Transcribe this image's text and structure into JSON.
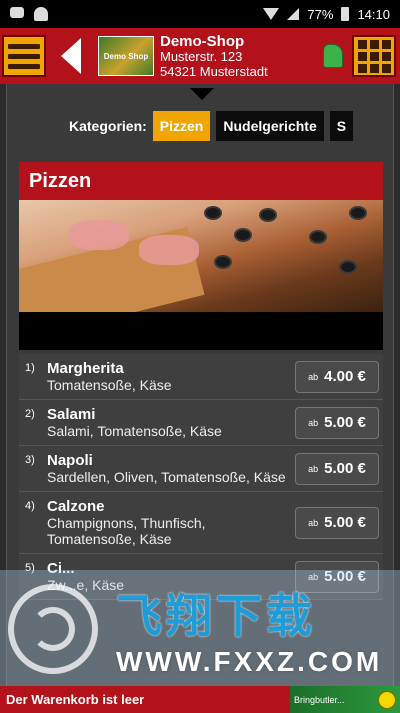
{
  "statusbar": {
    "battery": "77%",
    "time": "14:10"
  },
  "header": {
    "logo_text": "Demo Shop",
    "shop_name": "Demo-Shop",
    "street": "Musterstr. 123",
    "city": "54321 Musterstadt"
  },
  "categories": {
    "label": "Kategorien:",
    "tabs": [
      "Pizzen",
      "Nudelgerichte",
      "S"
    ]
  },
  "section": {
    "title": "Pizzen"
  },
  "items": [
    {
      "num": "1)",
      "title": "Margherita",
      "desc": "Tomatensoße, Käse",
      "ab": "ab",
      "price": "4.00 €"
    },
    {
      "num": "2)",
      "title": "Salami",
      "desc": "Salami, Tomatensoße, Käse",
      "ab": "ab",
      "price": "5.00 €"
    },
    {
      "num": "3)",
      "title": "Napoli",
      "desc": "Sardellen, Oliven, Tomatensoße, Käse",
      "ab": "ab",
      "price": "5.00 €"
    },
    {
      "num": "4)",
      "title": "Calzone",
      "desc": "Champignons, Thunfisch, Tomatensoße, Käse",
      "ab": "ab",
      "price": "5.00 €"
    },
    {
      "num": "5)",
      "title": "Ci...",
      "desc": "Zw...e, Käse",
      "ab": "ab",
      "price": "5.00 €"
    }
  ],
  "watermark": {
    "cn": "飞翔下载",
    "url": "WWW.FXXZ.COM"
  },
  "footer": {
    "cart": "Der Warenkorb ist leer",
    "bring": "Bringbutler..."
  }
}
